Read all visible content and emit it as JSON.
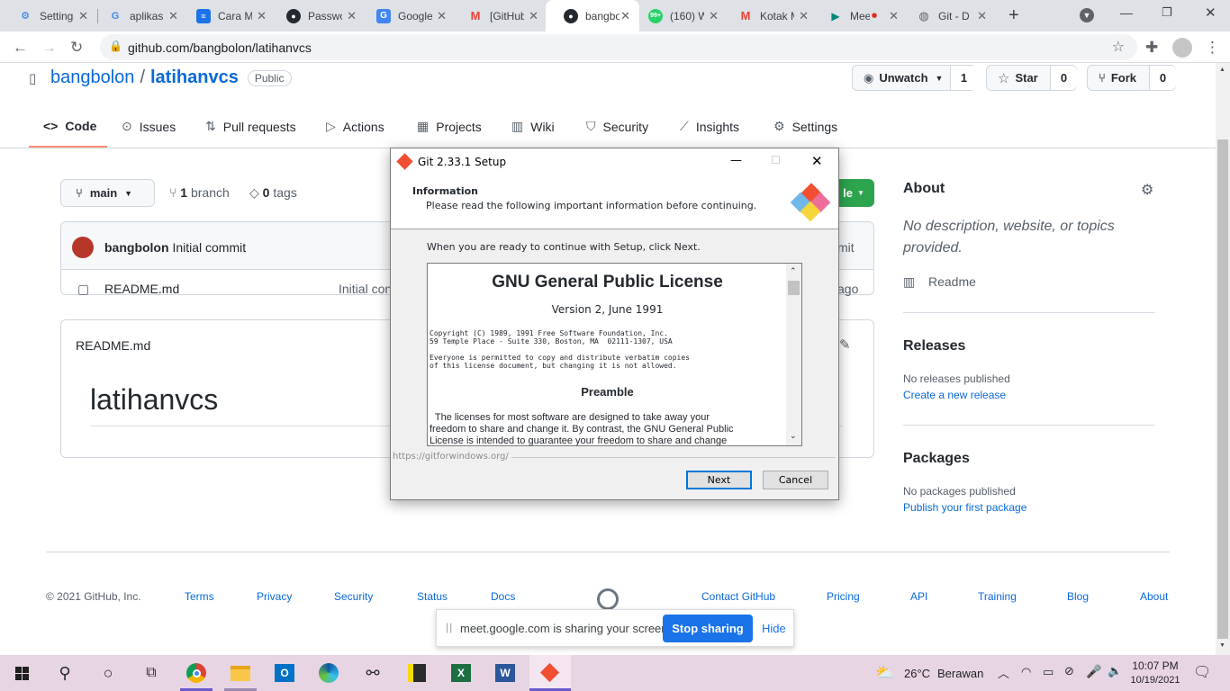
{
  "browser": {
    "tabs": [
      {
        "title": "Settings",
        "icon": "gear-icon",
        "color": "#1a73e8"
      },
      {
        "title": "aplikasi",
        "icon": "google-icon",
        "color": "#4285f4"
      },
      {
        "title": "Cara M",
        "icon": "wave-icon",
        "color": "#1a73e8"
      },
      {
        "title": "Password",
        "icon": "github-icon",
        "color": "#24292f"
      },
      {
        "title": "Google",
        "icon": "translate-icon",
        "color": "#4285f4"
      },
      {
        "title": "[GitHub]",
        "icon": "gmail-icon",
        "color": "#ea4335"
      },
      {
        "title": "bangbolon",
        "icon": "github-icon",
        "color": "#24292f"
      },
      {
        "title": "(160) W",
        "icon": "whatsapp-icon",
        "color": "#25d366"
      },
      {
        "title": "Kotak M",
        "icon": "gmail-icon",
        "color": "#ea4335"
      },
      {
        "title": "Meet",
        "icon": "meet-icon",
        "color": "#00897b"
      },
      {
        "title": "Git - D",
        "icon": "globe-icon",
        "color": "#5f6368"
      }
    ],
    "url": "github.com/bangbolon/latihanvcs"
  },
  "repo": {
    "owner": "bangbolon",
    "separator": "/",
    "name": "latihanvcs",
    "visibility": "Public",
    "unwatch_label": "Unwatch",
    "watch_count": "1",
    "star_label": "Star",
    "star_count": "0",
    "fork_label": "Fork",
    "fork_count": "0"
  },
  "nav": {
    "tabs": [
      "Code",
      "Issues",
      "Pull requests",
      "Actions",
      "Projects",
      "Wiki",
      "Security",
      "Insights",
      "Settings"
    ]
  },
  "files": {
    "branch_label": "main",
    "branch_count": "1",
    "branch_word": "branch",
    "tags_count": "0",
    "tags_word": "tags",
    "code_btn_partial": "le",
    "commit_author": "bangbolon",
    "commit_message": "Initial commit",
    "commit_right_partial": "mit",
    "file_name": "README.md",
    "file_commit": "Initial con",
    "file_time_partial": "ago",
    "readme_header": "README.md",
    "readme_title": "latihanvcs"
  },
  "about": {
    "heading": "About",
    "description": "No description, website, or topics provided.",
    "readme_label": "Readme",
    "releases_heading": "Releases",
    "releases_none": "No releases published",
    "releases_link": "Create a new release",
    "packages_heading": "Packages",
    "packages_none": "No packages published",
    "packages_link": "Publish your first package"
  },
  "footer": {
    "copyright": "© 2021 GitHub, Inc.",
    "links_left": [
      "Terms",
      "Privacy",
      "Security",
      "Status",
      "Docs"
    ],
    "links_right": [
      "Contact GitHub",
      "Pricing",
      "API",
      "Training",
      "Blog",
      "About"
    ]
  },
  "share_bar": {
    "message": "meet.google.com is sharing your screen.",
    "stop_label": "Stop sharing",
    "hide_label": "Hide"
  },
  "dialog": {
    "title": "Git 2.33.1 Setup",
    "header_title": "Information",
    "header_subtitle": "Please read the following important information before continuing.",
    "instruction": "When you are ready to continue with Setup, click Next.",
    "license_title": "GNU General Public License",
    "license_version": "Version 2, June 1991",
    "copyright_1": "Copyright (C) 1989, 1991 Free Software Foundation, Inc.",
    "copyright_2": "59 Temple Place - Suite 330, Boston, MA  02111-1307, USA",
    "everyone_1": "Everyone is permitted to copy and distribute verbatim copies",
    "everyone_2": "of this license document, but changing it is not allowed.",
    "preamble_heading": "Preamble",
    "preamble_1": "  The licenses for most software are designed to take away your",
    "preamble_2": "freedom to share and change it. By contrast, the GNU General Public",
    "preamble_3": "License is intended to guarantee your freedom to share and change",
    "footer_url": "https://gitforwindows.org/",
    "next_label": "Next",
    "cancel_label": "Cancel"
  },
  "taskbar": {
    "weather_temp": "26°C",
    "weather_desc": "Berawan",
    "time": "10:07 PM",
    "date": "10/19/2021"
  }
}
